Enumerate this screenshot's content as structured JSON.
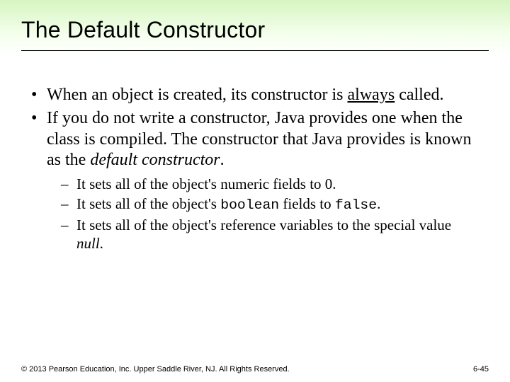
{
  "title": "The Default Constructor",
  "bullets": [
    {
      "pre": "When an object is created, its constructor is ",
      "u": "always",
      "post": " called."
    },
    {
      "pre": "If you do not write a constructor, Java provides one when the class is compiled.  The constructor that Java provides is known as the ",
      "i": "default constructor",
      "post": "."
    }
  ],
  "sub": [
    {
      "text": "It sets all of the object's numeric fields to 0."
    },
    {
      "pre": "It sets all of the object's ",
      "mono1": "boolean",
      "mid": " fields to ",
      "mono2": "false",
      "post": "."
    },
    {
      "pre": "It sets all of the object's reference variables to the special value ",
      "i": "null",
      "post": "."
    }
  ],
  "footer": {
    "copyright": "© 2013 Pearson Education, Inc. Upper Saddle River, NJ. All Rights Reserved.",
    "pagenum": "6-45"
  }
}
